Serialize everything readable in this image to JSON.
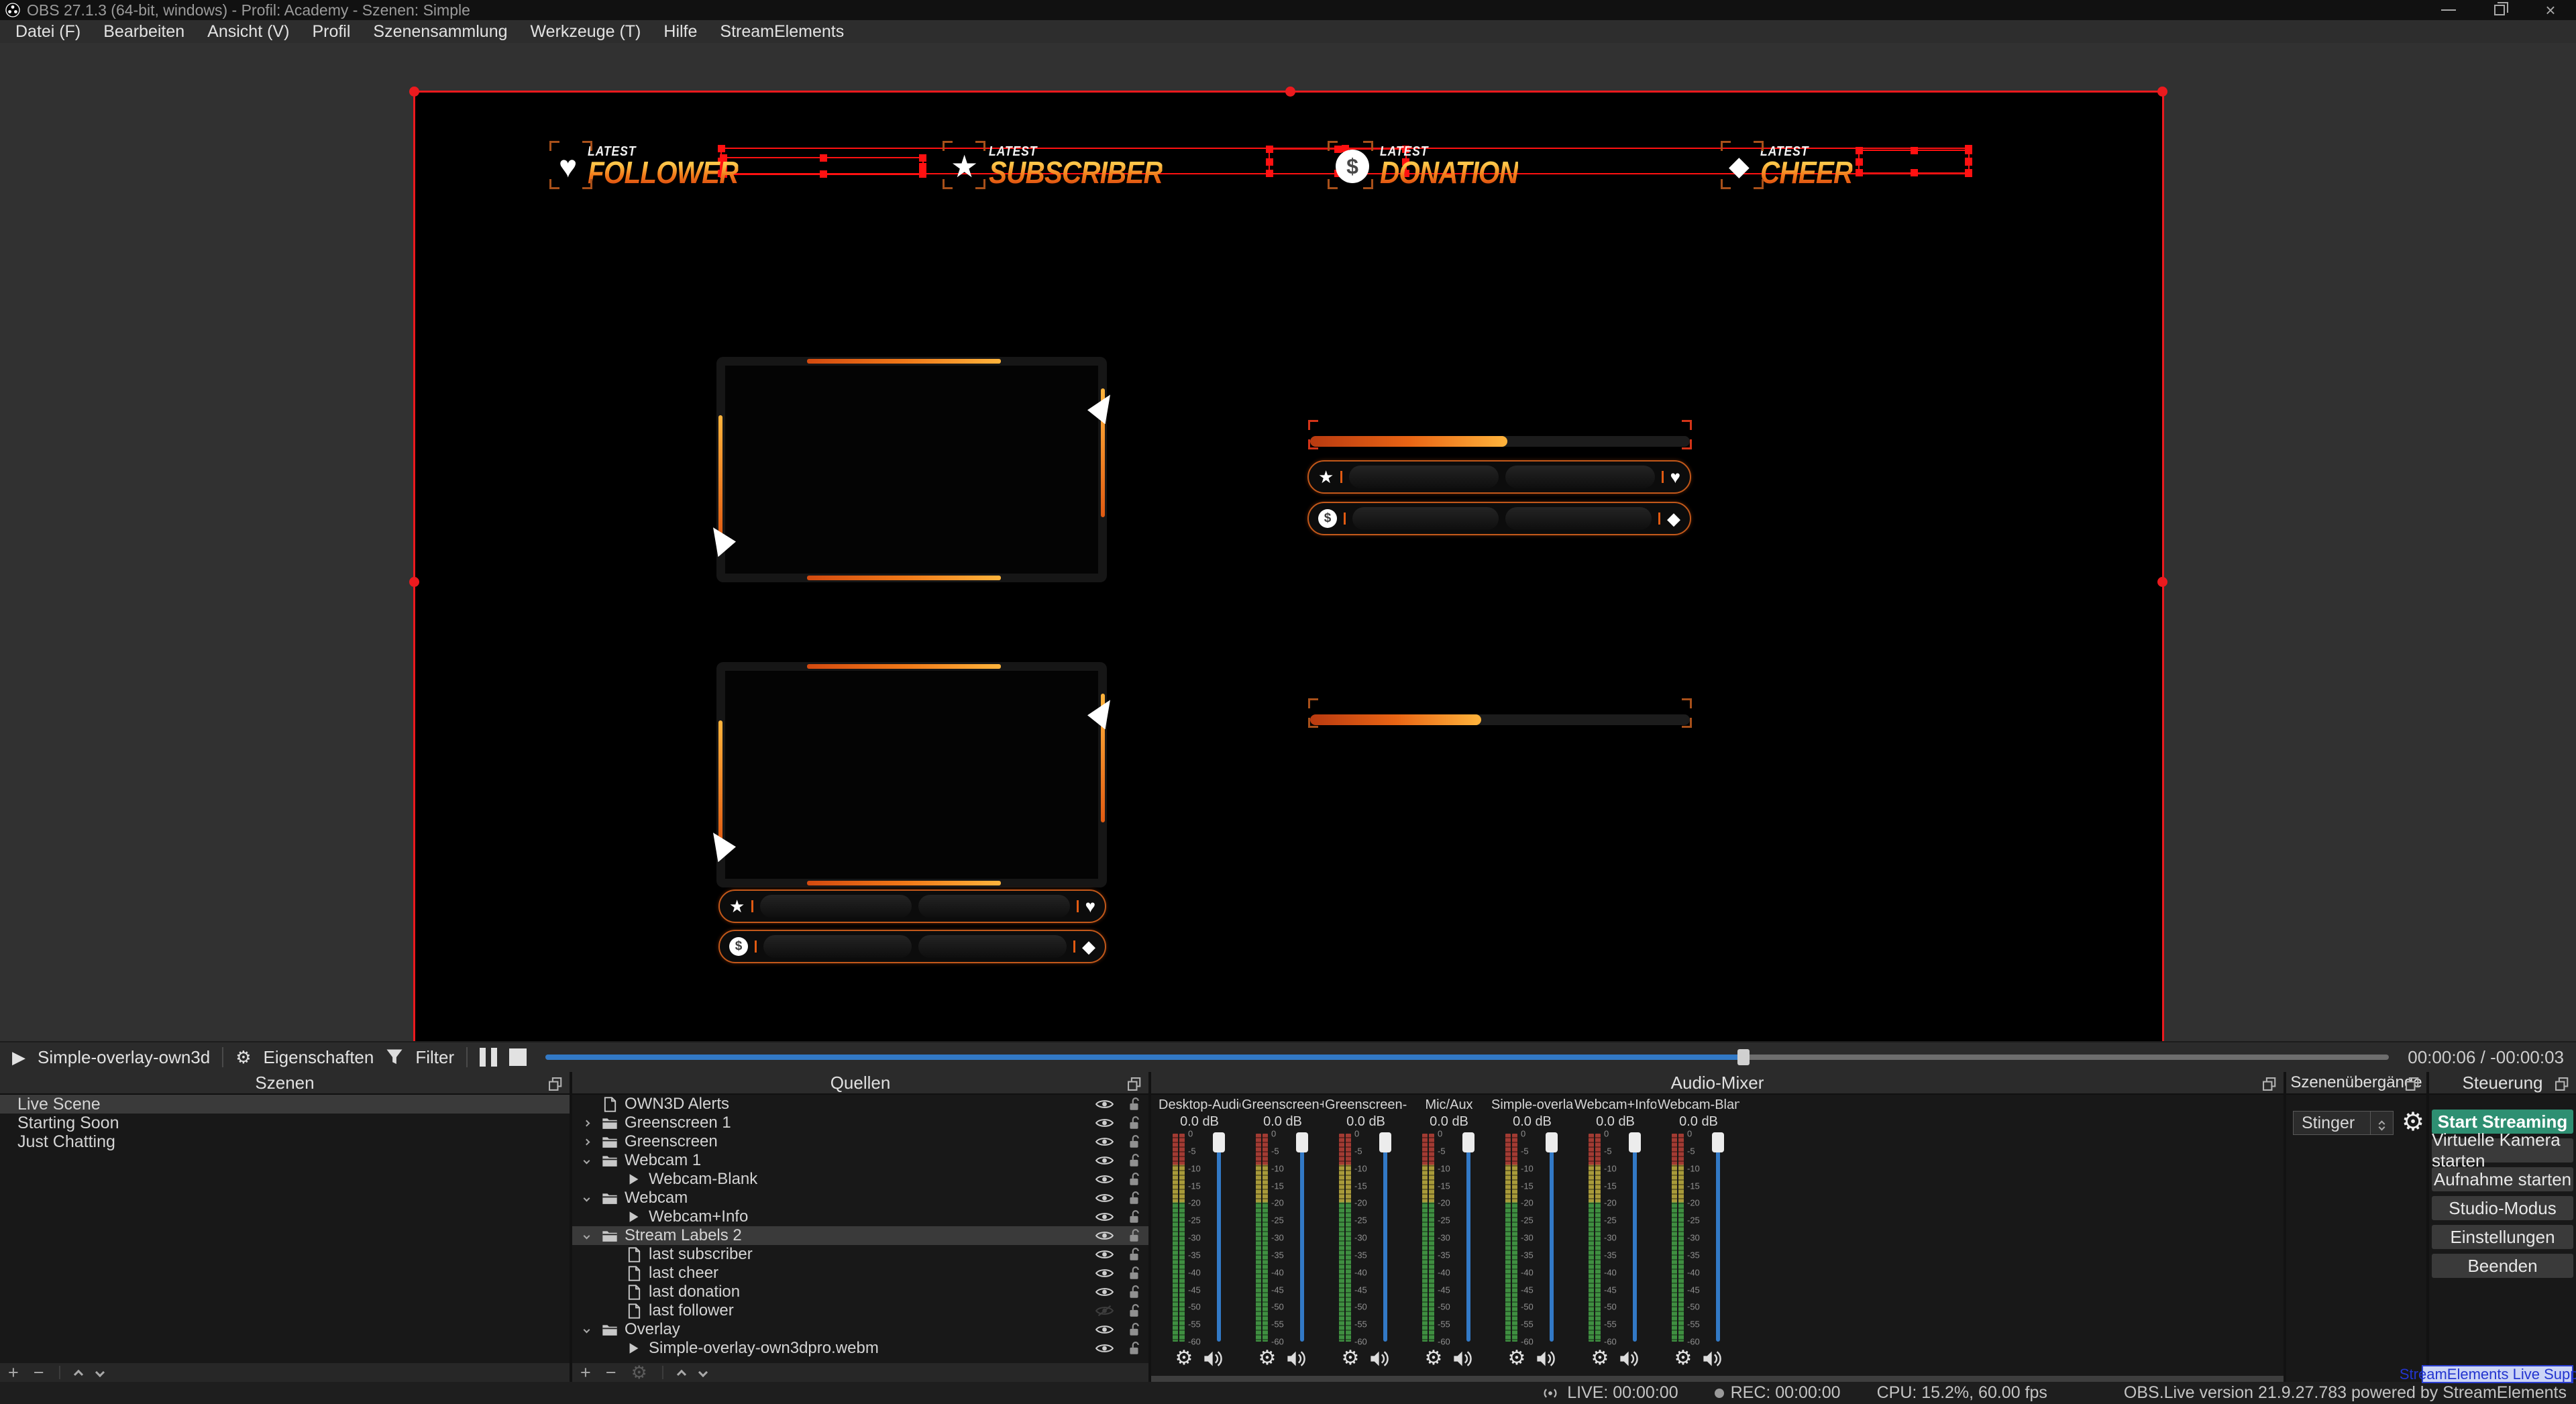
{
  "window": {
    "title": "OBS 27.1.3 (64-bit, windows) - Profil: Academy - Szenen: Simple"
  },
  "menu": {
    "items": [
      "Datei (F)",
      "Bearbeiten",
      "Ansicht (V)",
      "Profil",
      "Szenensammlung",
      "Werkzeuge (T)",
      "Hilfe",
      "StreamElements"
    ]
  },
  "icons": {
    "add": "+",
    "remove": "−",
    "gear": "⚙",
    "heart": "♥",
    "star": "★",
    "diamond": "◆",
    "play": "▶",
    "dollar": "$"
  },
  "preview": {
    "banner_widgets": [
      {
        "id": "follower",
        "icon": "heart-icon",
        "eyebrow": "LATEST",
        "label": "FOLLOWER"
      },
      {
        "id": "subscriber",
        "icon": "star-icon",
        "eyebrow": "LATEST",
        "label": "SUBSCRIBER"
      },
      {
        "id": "donation",
        "icon": "dollar-icon",
        "eyebrow": "LATEST",
        "label": "DONATION"
      },
      {
        "id": "cheer",
        "icon": "diamond-icon",
        "eyebrow": "LATEST",
        "label": "CHEER"
      }
    ],
    "label_bars": [
      {
        "left_icon": "star-icon",
        "right_icon": "heart-icon"
      },
      {
        "left_icon": "dollar-icon",
        "right_icon": "diamond-icon"
      }
    ],
    "progress_bars": [
      {
        "fill_percent": 52
      },
      {
        "fill_percent": 45
      }
    ]
  },
  "media_bar": {
    "source_label": "Simple-overlay-own3d",
    "properties_label": "Eigenschaften",
    "filter_label": "Filter",
    "time": "00:00:06 / -00:00:03",
    "progress_percent": 65
  },
  "scenes_panel": {
    "title": "Szenen",
    "items": [
      {
        "label": "Live Scene",
        "selected": true
      },
      {
        "label": "Starting Soon",
        "selected": false
      },
      {
        "label": "Just Chatting",
        "selected": false
      }
    ]
  },
  "sources_panel": {
    "title": "Quellen",
    "items": [
      {
        "label": "OWN3D Alerts",
        "type": "page",
        "expander": null,
        "indent": 0,
        "visible": true,
        "selected": false
      },
      {
        "label": "Greenscreen 1",
        "type": "folder",
        "expander": "right",
        "indent": 0,
        "visible": true,
        "selected": false
      },
      {
        "label": "Greenscreen",
        "type": "folder",
        "expander": "right",
        "indent": 0,
        "visible": true,
        "selected": false
      },
      {
        "label": "Webcam 1",
        "type": "folder",
        "expander": "down",
        "indent": 0,
        "visible": true,
        "selected": false
      },
      {
        "label": "Webcam-Blank",
        "type": "media",
        "expander": null,
        "indent": 1,
        "visible": true,
        "selected": false
      },
      {
        "label": "Webcam",
        "type": "folder",
        "expander": "down",
        "indent": 0,
        "visible": true,
        "selected": false
      },
      {
        "label": "Webcam+Info",
        "type": "media",
        "expander": null,
        "indent": 1,
        "visible": true,
        "selected": false
      },
      {
        "label": "Stream Labels 2",
        "type": "folder",
        "expander": "down",
        "indent": 0,
        "visible": true,
        "selected": true
      },
      {
        "label": "last subscriber",
        "type": "page",
        "expander": null,
        "indent": 1,
        "visible": true,
        "selected": false
      },
      {
        "label": "last cheer",
        "type": "page",
        "expander": null,
        "indent": 1,
        "visible": true,
        "selected": false
      },
      {
        "label": "last donation",
        "type": "page",
        "expander": null,
        "indent": 1,
        "visible": true,
        "selected": false
      },
      {
        "label": "last follower",
        "type": "page",
        "expander": null,
        "indent": 1,
        "visible": false,
        "selected": false
      },
      {
        "label": "Overlay",
        "type": "folder",
        "expander": "down",
        "indent": 0,
        "visible": true,
        "selected": false
      },
      {
        "label": "Simple-overlay-own3dpro.webm",
        "type": "media",
        "expander": null,
        "indent": 1,
        "visible": true,
        "selected": false
      }
    ]
  },
  "mixer_panel": {
    "title": "Audio-Mixer",
    "channels": [
      {
        "name": "Desktop-Audio",
        "db": "0.0 dB"
      },
      {
        "name": "Greenscreen+Inf",
        "db": "0.0 dB"
      },
      {
        "name": "Greenscreen-Blar",
        "db": "0.0 dB"
      },
      {
        "name": "Mic/Aux",
        "db": "0.0 dB"
      },
      {
        "name": "Simple-overlay-o",
        "db": "0.0 dB"
      },
      {
        "name": "Webcam+Info",
        "db": "0.0 dB"
      },
      {
        "name": "Webcam-Blank",
        "db": "0.0 dB"
      }
    ],
    "scale_ticks": [
      "0",
      "-5",
      "-10",
      "-15",
      "-20",
      "-25",
      "-30",
      "-35",
      "-40",
      "-45",
      "-50",
      "-55",
      "-60"
    ]
  },
  "transitions_panel": {
    "title": "Szenenübergänge",
    "selected_transition": "Stinger"
  },
  "controls_panel": {
    "title": "Steuerung",
    "buttons": [
      {
        "label": "Start Streaming",
        "primary": true
      },
      {
        "label": "Virtuelle Kamera starten",
        "primary": false
      },
      {
        "label": "Aufnahme starten",
        "primary": false
      },
      {
        "label": "Studio-Modus",
        "primary": false
      },
      {
        "label": "Einstellungen",
        "primary": false
      },
      {
        "label": "Beenden",
        "primary": false
      }
    ]
  },
  "status_bar": {
    "live": "LIVE: 00:00:00",
    "rec": "REC: 00:00:00",
    "cpu": "CPU: 15.2%, 60.00 fps",
    "version": "OBS.Live version 21.9.27.783 powered by StreamElements"
  },
  "support_button": {
    "label": "StreamElements Live Support"
  },
  "colors": {
    "accent_red": "#eb1a1e",
    "accent_orange": "#e86414",
    "accent_orange_light": "#ffb43c",
    "streaming_green": "#2e8f72",
    "slider_blue": "#3279c6"
  }
}
